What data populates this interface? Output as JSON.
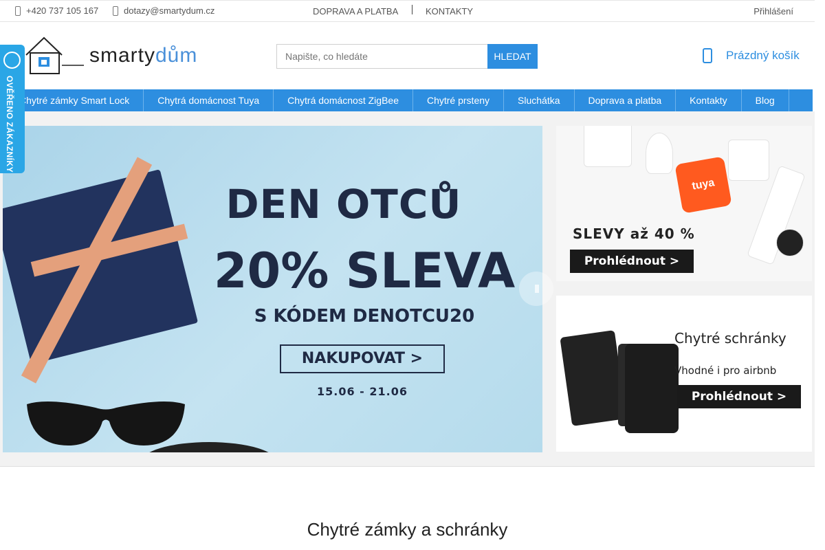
{
  "topbar": {
    "phone": "+420 737 105 167",
    "email": "dotazy@smartydum.cz",
    "link1": "DOPRAVA A PLATBA",
    "link2": "KONTAKTY",
    "login": "Přihlášení"
  },
  "logo": {
    "text_main": "smarty",
    "text_accent": "dům"
  },
  "search": {
    "placeholder": "Napište, co hledáte",
    "button": "HLEDAT"
  },
  "cart": {
    "label": "Prázdný košík"
  },
  "badge": {
    "text": "OVĚŘENO ZÁKAZNÍKY"
  },
  "nav": {
    "items": [
      "Chytré zámky Smart Lock",
      "Chytrá domácnost Tuya",
      "Chytrá domácnost ZigBee",
      "Chytré prsteny",
      "Sluchátka",
      "Doprava a platba",
      "Kontakty",
      "Blog"
    ]
  },
  "hero": {
    "line1": "DEN OTCŮ",
    "line2": "20% SLEVA",
    "line3": "S KÓDEM DENOTCU20",
    "cta": "NAKUPOVAT >",
    "dates": "15.06 - 21.06"
  },
  "side1": {
    "tuya": "tuya",
    "offer": "SLEVY až 40 %",
    "cta": "Prohlédnout >"
  },
  "side2": {
    "title": "Chytré schránky",
    "subtitle": "Vhodné i pro airbnb",
    "cta": "Prohlédnout >"
  },
  "section": {
    "title": "Chytré zámky a schránky"
  }
}
